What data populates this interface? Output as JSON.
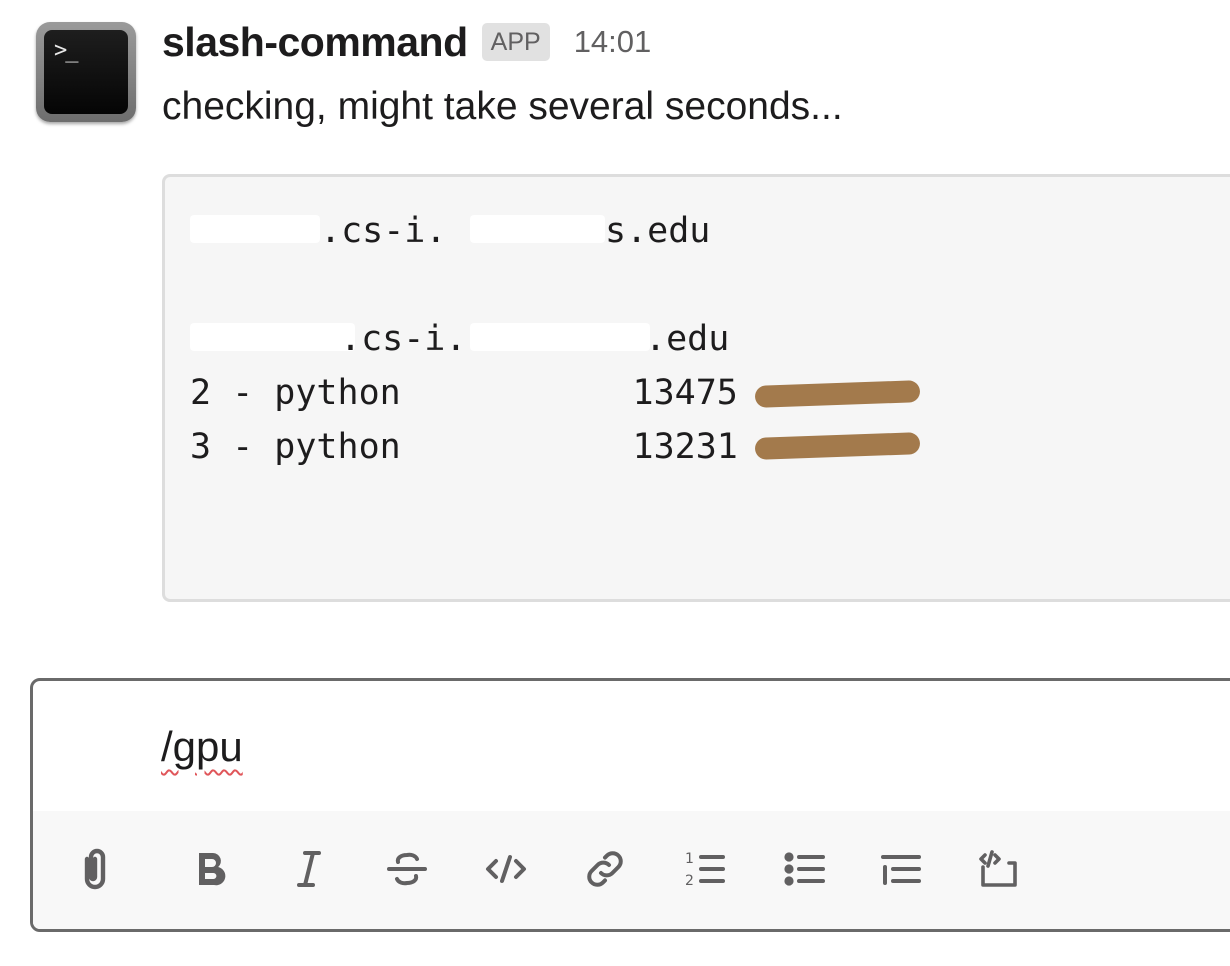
{
  "message": {
    "sender": "slash-command",
    "badge": "APP",
    "timestamp": "14:01",
    "text": "checking, might take several seconds...",
    "avatar_icon": "terminal-icon",
    "avatar_glyph": ">_"
  },
  "code_block": {
    "lines": [
      ".cs-i.",
      "s.edu",
      ".cs-i.",
      ".edu",
      "2 - python           13475",
      "3 - python           13231"
    ]
  },
  "composer": {
    "value": "/gpu"
  },
  "toolbar": {
    "buttons": [
      "attach-icon",
      "bold-icon",
      "italic-icon",
      "strikethrough-icon",
      "code-icon",
      "link-icon",
      "ordered-list-icon",
      "bulleted-list-icon",
      "blockquote-icon",
      "code-block-icon"
    ]
  },
  "colors": {
    "redaction_scribble": "#a37a4c",
    "spellcheck": "#e0565a"
  }
}
